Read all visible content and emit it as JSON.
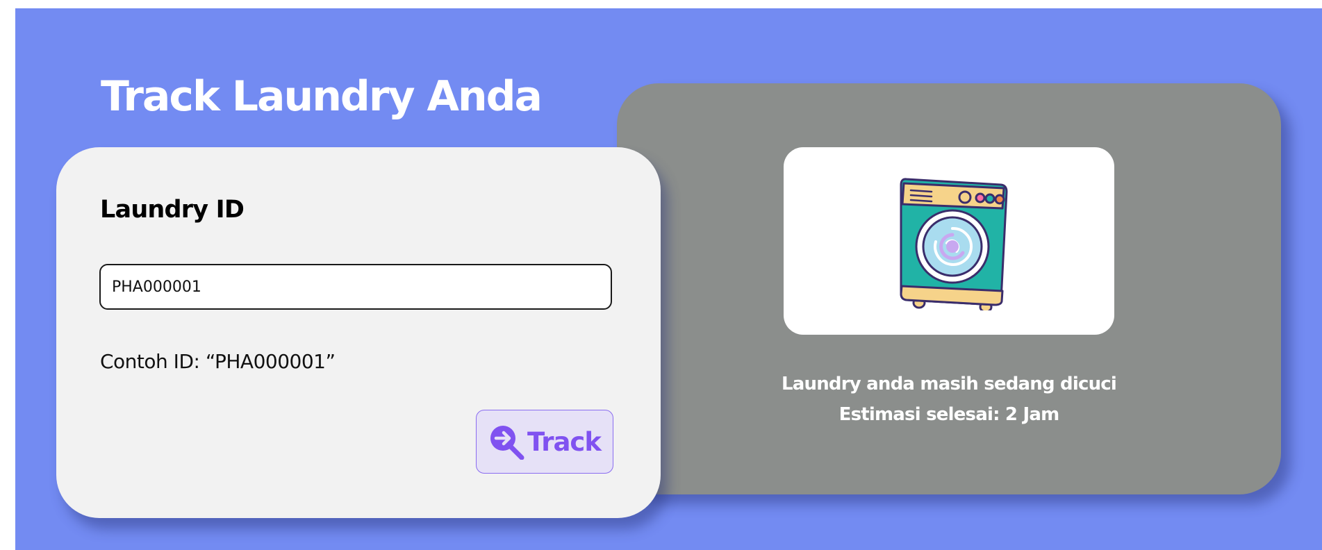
{
  "page": {
    "title": "Track Laundry Anda",
    "background_color": "#738bf2"
  },
  "form": {
    "label": "Laundry ID",
    "input_value": "PHA000001",
    "example_text": "Contoh ID: “PHA000001”",
    "track_button": {
      "label": "Track",
      "icon": "search-arrow-icon",
      "accent_color": "#8052f0"
    }
  },
  "status": {
    "illustration": "washing-machine-icon",
    "line_1": "Laundry anda masih sedang dicuci",
    "line_2": "Estimasi selesai: 2 Jam"
  }
}
